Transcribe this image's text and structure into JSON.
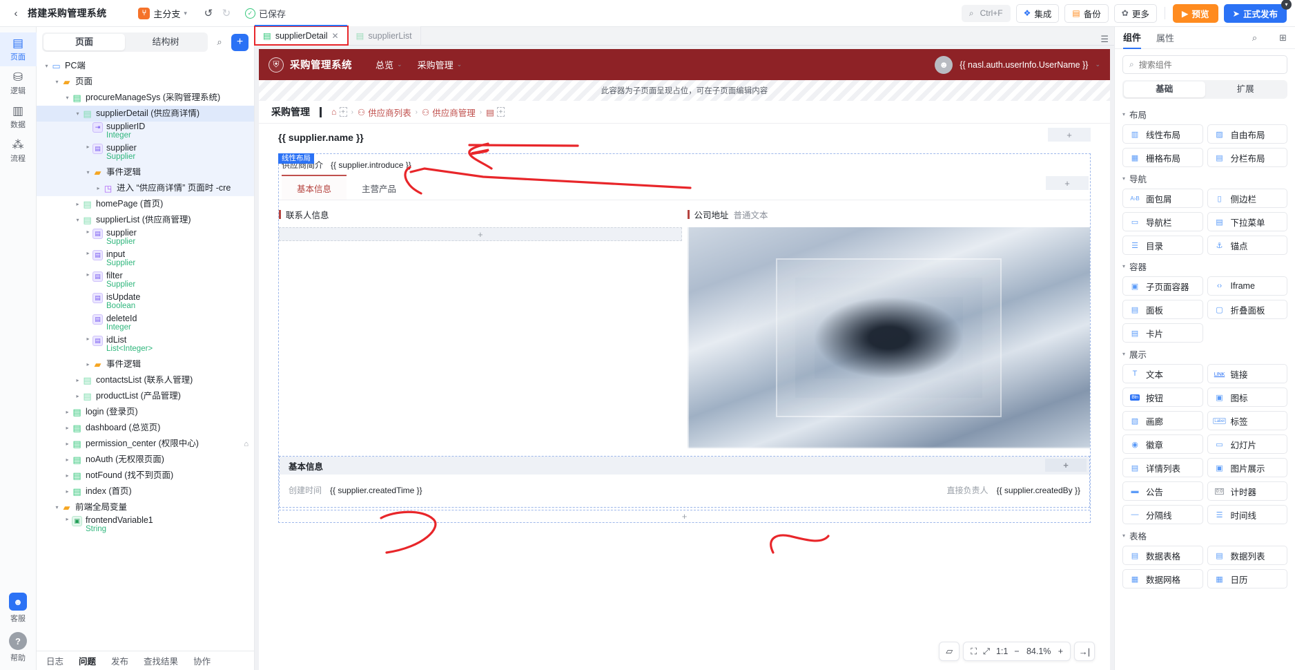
{
  "topbar": {
    "back_icon": "chevron-left-icon",
    "title": "搭建采购管理系统",
    "branch": {
      "icon_letter": "⑂",
      "label": "主分支"
    },
    "undo_icon": "undo-icon",
    "redo_icon": "redo-icon",
    "saved_label": "已保存",
    "search": {
      "icon": "search-icon",
      "shortcut": "Ctrl+F"
    },
    "buttons": [
      {
        "name": "integration",
        "icon": "layers-icon",
        "label": "集成"
      },
      {
        "name": "backup",
        "icon": "database-icon",
        "label": "备份"
      },
      {
        "name": "more",
        "icon": "gear-icon",
        "label": "更多"
      }
    ],
    "preview": {
      "icon": "play-icon",
      "label": "预览"
    },
    "publish": {
      "icon": "send-icon",
      "label": "正式发布",
      "badge": "▾"
    }
  },
  "rail": {
    "items": [
      {
        "glyph": "▤",
        "label": "页面",
        "active": true
      },
      {
        "glyph": "⚙",
        "label": "逻辑",
        "active": false
      },
      {
        "glyph": "▥",
        "label": "数据",
        "active": false
      },
      {
        "glyph": "⁂",
        "label": "流程",
        "active": false
      }
    ],
    "bottom": [
      {
        "glyph": "☺",
        "label": "客服"
      },
      {
        "glyph": "?",
        "label": "帮助"
      }
    ]
  },
  "leftpanel": {
    "tabs": [
      {
        "label": "页面",
        "active": true
      },
      {
        "label": "结构树",
        "active": false
      }
    ],
    "search_icon": "search-icon",
    "add_icon": "plus-icon",
    "tree": [
      {
        "depth": 0,
        "arrow": "▾",
        "icon": "monitor-icon",
        "icon_class": "ic-pc",
        "name": "PC端",
        "type": "",
        "state": ""
      },
      {
        "depth": 1,
        "arrow": "▾",
        "icon": "folder-icon",
        "icon_class": "ic-folder",
        "name": "页面",
        "type": "",
        "state": ""
      },
      {
        "depth": 2,
        "arrow": "▾",
        "icon": "page-icon",
        "icon_class": "ic-page",
        "name": "procureManageSys (采购管理系统)",
        "type": "",
        "state": ""
      },
      {
        "depth": 3,
        "arrow": "▾",
        "icon": "page-icon",
        "icon_class": "ic-page hollow",
        "name": "supplierDetail (供应商详情)",
        "type": "",
        "state": "sel"
      },
      {
        "depth": 4,
        "arrow": "",
        "icon": "param-icon",
        "icon_class": "ic-param",
        "name": "supplierID",
        "type": "Integer",
        "state": "hl"
      },
      {
        "depth": 4,
        "arrow": "▸",
        "icon": "variable-icon",
        "icon_class": "ic-var",
        "name": "supplier",
        "type": "Supplier",
        "state": "hl"
      },
      {
        "depth": 4,
        "arrow": "▾",
        "icon": "folder-icon",
        "icon_class": "ic-folder",
        "name": "事件逻辑",
        "type": "",
        "state": "hl"
      },
      {
        "depth": 5,
        "arrow": "▸",
        "icon": "event-icon",
        "icon_class": "ic-evt",
        "name": "进入 “供应商详情” 页面时 -cre",
        "type": "",
        "state": "hl"
      },
      {
        "depth": 3,
        "arrow": "▸",
        "icon": "page-icon",
        "icon_class": "ic-page hollow",
        "name": "homePage (首页)",
        "type": "",
        "state": ""
      },
      {
        "depth": 3,
        "arrow": "▾",
        "icon": "page-icon",
        "icon_class": "ic-page hollow",
        "name": "supplierList (供应商管理)",
        "type": "",
        "state": ""
      },
      {
        "depth": 4,
        "arrow": "▸",
        "icon": "variable-icon",
        "icon_class": "ic-var",
        "name": "supplier",
        "type": "Supplier",
        "state": ""
      },
      {
        "depth": 4,
        "arrow": "▸",
        "icon": "variable-icon",
        "icon_class": "ic-var",
        "name": "input",
        "type": "Supplier",
        "state": ""
      },
      {
        "depth": 4,
        "arrow": "▸",
        "icon": "variable-icon",
        "icon_class": "ic-var",
        "name": "filter",
        "type": "Supplier",
        "state": ""
      },
      {
        "depth": 4,
        "arrow": "",
        "icon": "variable-icon",
        "icon_class": "ic-var",
        "name": "isUpdate",
        "type": "Boolean",
        "state": ""
      },
      {
        "depth": 4,
        "arrow": "",
        "icon": "variable-icon",
        "icon_class": "ic-var",
        "name": "deleteId",
        "type": "Integer",
        "state": ""
      },
      {
        "depth": 4,
        "arrow": "▸",
        "icon": "variable-icon",
        "icon_class": "ic-var",
        "name": "idList",
        "type": "List<Integer>",
        "state": ""
      },
      {
        "depth": 4,
        "arrow": "▸",
        "icon": "folder-icon",
        "icon_class": "ic-folder",
        "name": "事件逻辑",
        "type": "",
        "state": ""
      },
      {
        "depth": 3,
        "arrow": "▸",
        "icon": "page-icon",
        "icon_class": "ic-page hollow",
        "name": "contactsList (联系人管理)",
        "type": "",
        "state": ""
      },
      {
        "depth": 3,
        "arrow": "▸",
        "icon": "page-icon",
        "icon_class": "ic-page hollow",
        "name": "productList (产品管理)",
        "type": "",
        "state": ""
      },
      {
        "depth": 2,
        "arrow": "▸",
        "icon": "page-icon",
        "icon_class": "ic-page",
        "name": "login (登录页)",
        "type": "",
        "state": ""
      },
      {
        "depth": 2,
        "arrow": "▸",
        "icon": "page-icon",
        "icon_class": "ic-page",
        "name": "dashboard (总览页)",
        "type": "",
        "state": ""
      },
      {
        "depth": 2,
        "arrow": "▸",
        "icon": "page-icon",
        "icon_class": "ic-page",
        "name": "permission_center (权限中心)",
        "type": "",
        "state": "",
        "home": "⌂"
      },
      {
        "depth": 2,
        "arrow": "▸",
        "icon": "page-icon",
        "icon_class": "ic-page",
        "name": "noAuth (无权限页面)",
        "type": "",
        "state": ""
      },
      {
        "depth": 2,
        "arrow": "▸",
        "icon": "page-icon",
        "icon_class": "ic-page",
        "name": "notFound (找不到页面)",
        "type": "",
        "state": ""
      },
      {
        "depth": 2,
        "arrow": "▸",
        "icon": "page-icon",
        "icon_class": "ic-page",
        "name": "index (首页)",
        "type": "",
        "state": ""
      },
      {
        "depth": 1,
        "arrow": "▾",
        "icon": "folder-icon",
        "icon_class": "ic-folder",
        "name": "前端全局变量",
        "type": "",
        "state": ""
      },
      {
        "depth": 2,
        "arrow": "▸",
        "icon": "global-var-icon",
        "icon_class": "ic-gvar",
        "name": "frontendVariable1",
        "type": "String",
        "state": ""
      }
    ],
    "bottom_tabs": [
      {
        "label": "日志",
        "active": false
      },
      {
        "label": "问题",
        "active": true
      },
      {
        "label": "发布",
        "active": false
      },
      {
        "label": "查找结果",
        "active": false
      },
      {
        "label": "协作",
        "active": false
      }
    ]
  },
  "center": {
    "tabs": [
      {
        "label": "supplierDetail",
        "active": true,
        "closable": true,
        "highlighted": true
      },
      {
        "label": "supplierList",
        "active": false,
        "closable": false,
        "highlighted": false
      }
    ],
    "tabs_right_icon": "list-icon",
    "appbar": {
      "logo_icon": "shield-icon",
      "title": "采购管理系统",
      "menu": [
        {
          "label": "总览",
          "caret": "⌄"
        },
        {
          "label": "采购管理",
          "caret": "⌄"
        }
      ],
      "avatar_icon": "user-icon",
      "username": "{{ nasl.auth.userInfo.UserName }}",
      "caret": "⌄"
    },
    "placeholder_note": "此容器为子页面呈现占位，可在子页面编辑内容",
    "breadcrumb": {
      "title": "采购管理",
      "items": [
        {
          "icon": "home-icon",
          "label": "",
          "plus": "+"
        },
        {
          "icon": "user-icon",
          "label": "供应商列表"
        },
        {
          "icon": "user-icon",
          "label": "供应商管理"
        },
        {
          "icon": "clipboard-icon",
          "label": "",
          "plus": "+"
        }
      ]
    },
    "page": {
      "title": "{{ supplier.name }}",
      "selection_tag": "线性布局",
      "intro_label": "供应商简介",
      "intro_value": "{{ supplier.introduce }}",
      "tabs": [
        {
          "label": "基本信息",
          "active": true
        },
        {
          "label": "主营产品",
          "active": false
        }
      ],
      "left_section": {
        "title": "联系人信息",
        "dropzone": "+"
      },
      "right_section": {
        "title": "公司地址",
        "subtitle": "普通文本"
      },
      "basic_section": {
        "title": "基本信息",
        "add": "+",
        "fields": [
          {
            "label": "创建时间",
            "value": "{{ supplier.createdTime }}"
          },
          {
            "label": "直接负责人",
            "value": "{{ supplier.createdBy }}"
          }
        ]
      },
      "bottom_plus": "+",
      "add_pill": "+"
    },
    "zoombar": {
      "device_icon": "device-icon",
      "pointer_icon": "node-select-icon",
      "fit_icon": "fit-screen-icon",
      "ratio_label": "1:1",
      "minus": "−",
      "percent": "84.1%",
      "plus": "+",
      "collapse_icon": "collapse-right-icon"
    }
  },
  "rightpanel": {
    "tabs": [
      {
        "label": "组件",
        "active": true
      },
      {
        "label": "属性",
        "active": false
      }
    ],
    "search_icon": "search-icon",
    "panel_icon": "panel-toggle-icon",
    "search_placeholder": "搜索组件",
    "segments": [
      {
        "label": "基础",
        "active": true
      },
      {
        "label": "扩展",
        "active": false
      }
    ],
    "groups": [
      {
        "title": "布局",
        "items": [
          {
            "label": "线性布局",
            "icon": "columns-icon"
          },
          {
            "label": "自由布局",
            "icon": "free-layout-icon"
          },
          {
            "label": "栅格布局",
            "icon": "grid-layout-icon"
          },
          {
            "label": "分栏布局",
            "icon": "split-layout-icon"
          }
        ]
      },
      {
        "title": "导航",
        "items": [
          {
            "label": "面包屑",
            "icon": "breadcrumb-icon"
          },
          {
            "label": "侧边栏",
            "icon": "sidebar-icon"
          },
          {
            "label": "导航栏",
            "icon": "navbar-icon"
          },
          {
            "label": "下拉菜单",
            "icon": "dropdown-icon"
          },
          {
            "label": "目录",
            "icon": "toc-icon"
          },
          {
            "label": "锚点",
            "icon": "anchor-icon"
          }
        ]
      },
      {
        "title": "容器",
        "items": [
          {
            "label": "子页面容器",
            "icon": "subpage-icon"
          },
          {
            "label": "Iframe",
            "icon": "code-icon"
          },
          {
            "label": "面板",
            "icon": "panel-icon"
          },
          {
            "label": "折叠面板",
            "icon": "collapse-panel-icon"
          },
          {
            "label": "卡片",
            "icon": "card-icon"
          }
        ]
      },
      {
        "title": "展示",
        "items": [
          {
            "label": "文本",
            "icon": "text-icon"
          },
          {
            "label": "链接",
            "icon": "link-icon"
          },
          {
            "label": "按钮",
            "icon": "button-icon"
          },
          {
            "label": "图标",
            "icon": "icon-icon"
          },
          {
            "label": "画廊",
            "icon": "gallery-icon"
          },
          {
            "label": "标签",
            "icon": "label-icon"
          },
          {
            "label": "徽章",
            "icon": "badge-icon"
          },
          {
            "label": "幻灯片",
            "icon": "slide-icon"
          },
          {
            "label": "详情列表",
            "icon": "detail-list-icon"
          },
          {
            "label": "图片展示",
            "icon": "image-icon"
          },
          {
            "label": "公告",
            "icon": "announcement-icon"
          },
          {
            "label": "计时器",
            "icon": "timer-icon"
          },
          {
            "label": "分隔线",
            "icon": "divider-icon"
          },
          {
            "label": "时间线",
            "icon": "timeline-icon"
          }
        ]
      },
      {
        "title": "表格",
        "items": [
          {
            "label": "数据表格",
            "icon": "data-table-icon"
          },
          {
            "label": "数据列表",
            "icon": "data-list-icon"
          },
          {
            "label": "数据网格",
            "icon": "data-grid-icon"
          },
          {
            "label": "日历",
            "icon": "calendar-icon"
          }
        ]
      }
    ]
  },
  "colors": {
    "accent_blue": "#2b72f5",
    "orange": "#ff8b1f",
    "app_red": "#8e2226",
    "green": "#34c77b",
    "annotation_red": "#e8262a"
  }
}
